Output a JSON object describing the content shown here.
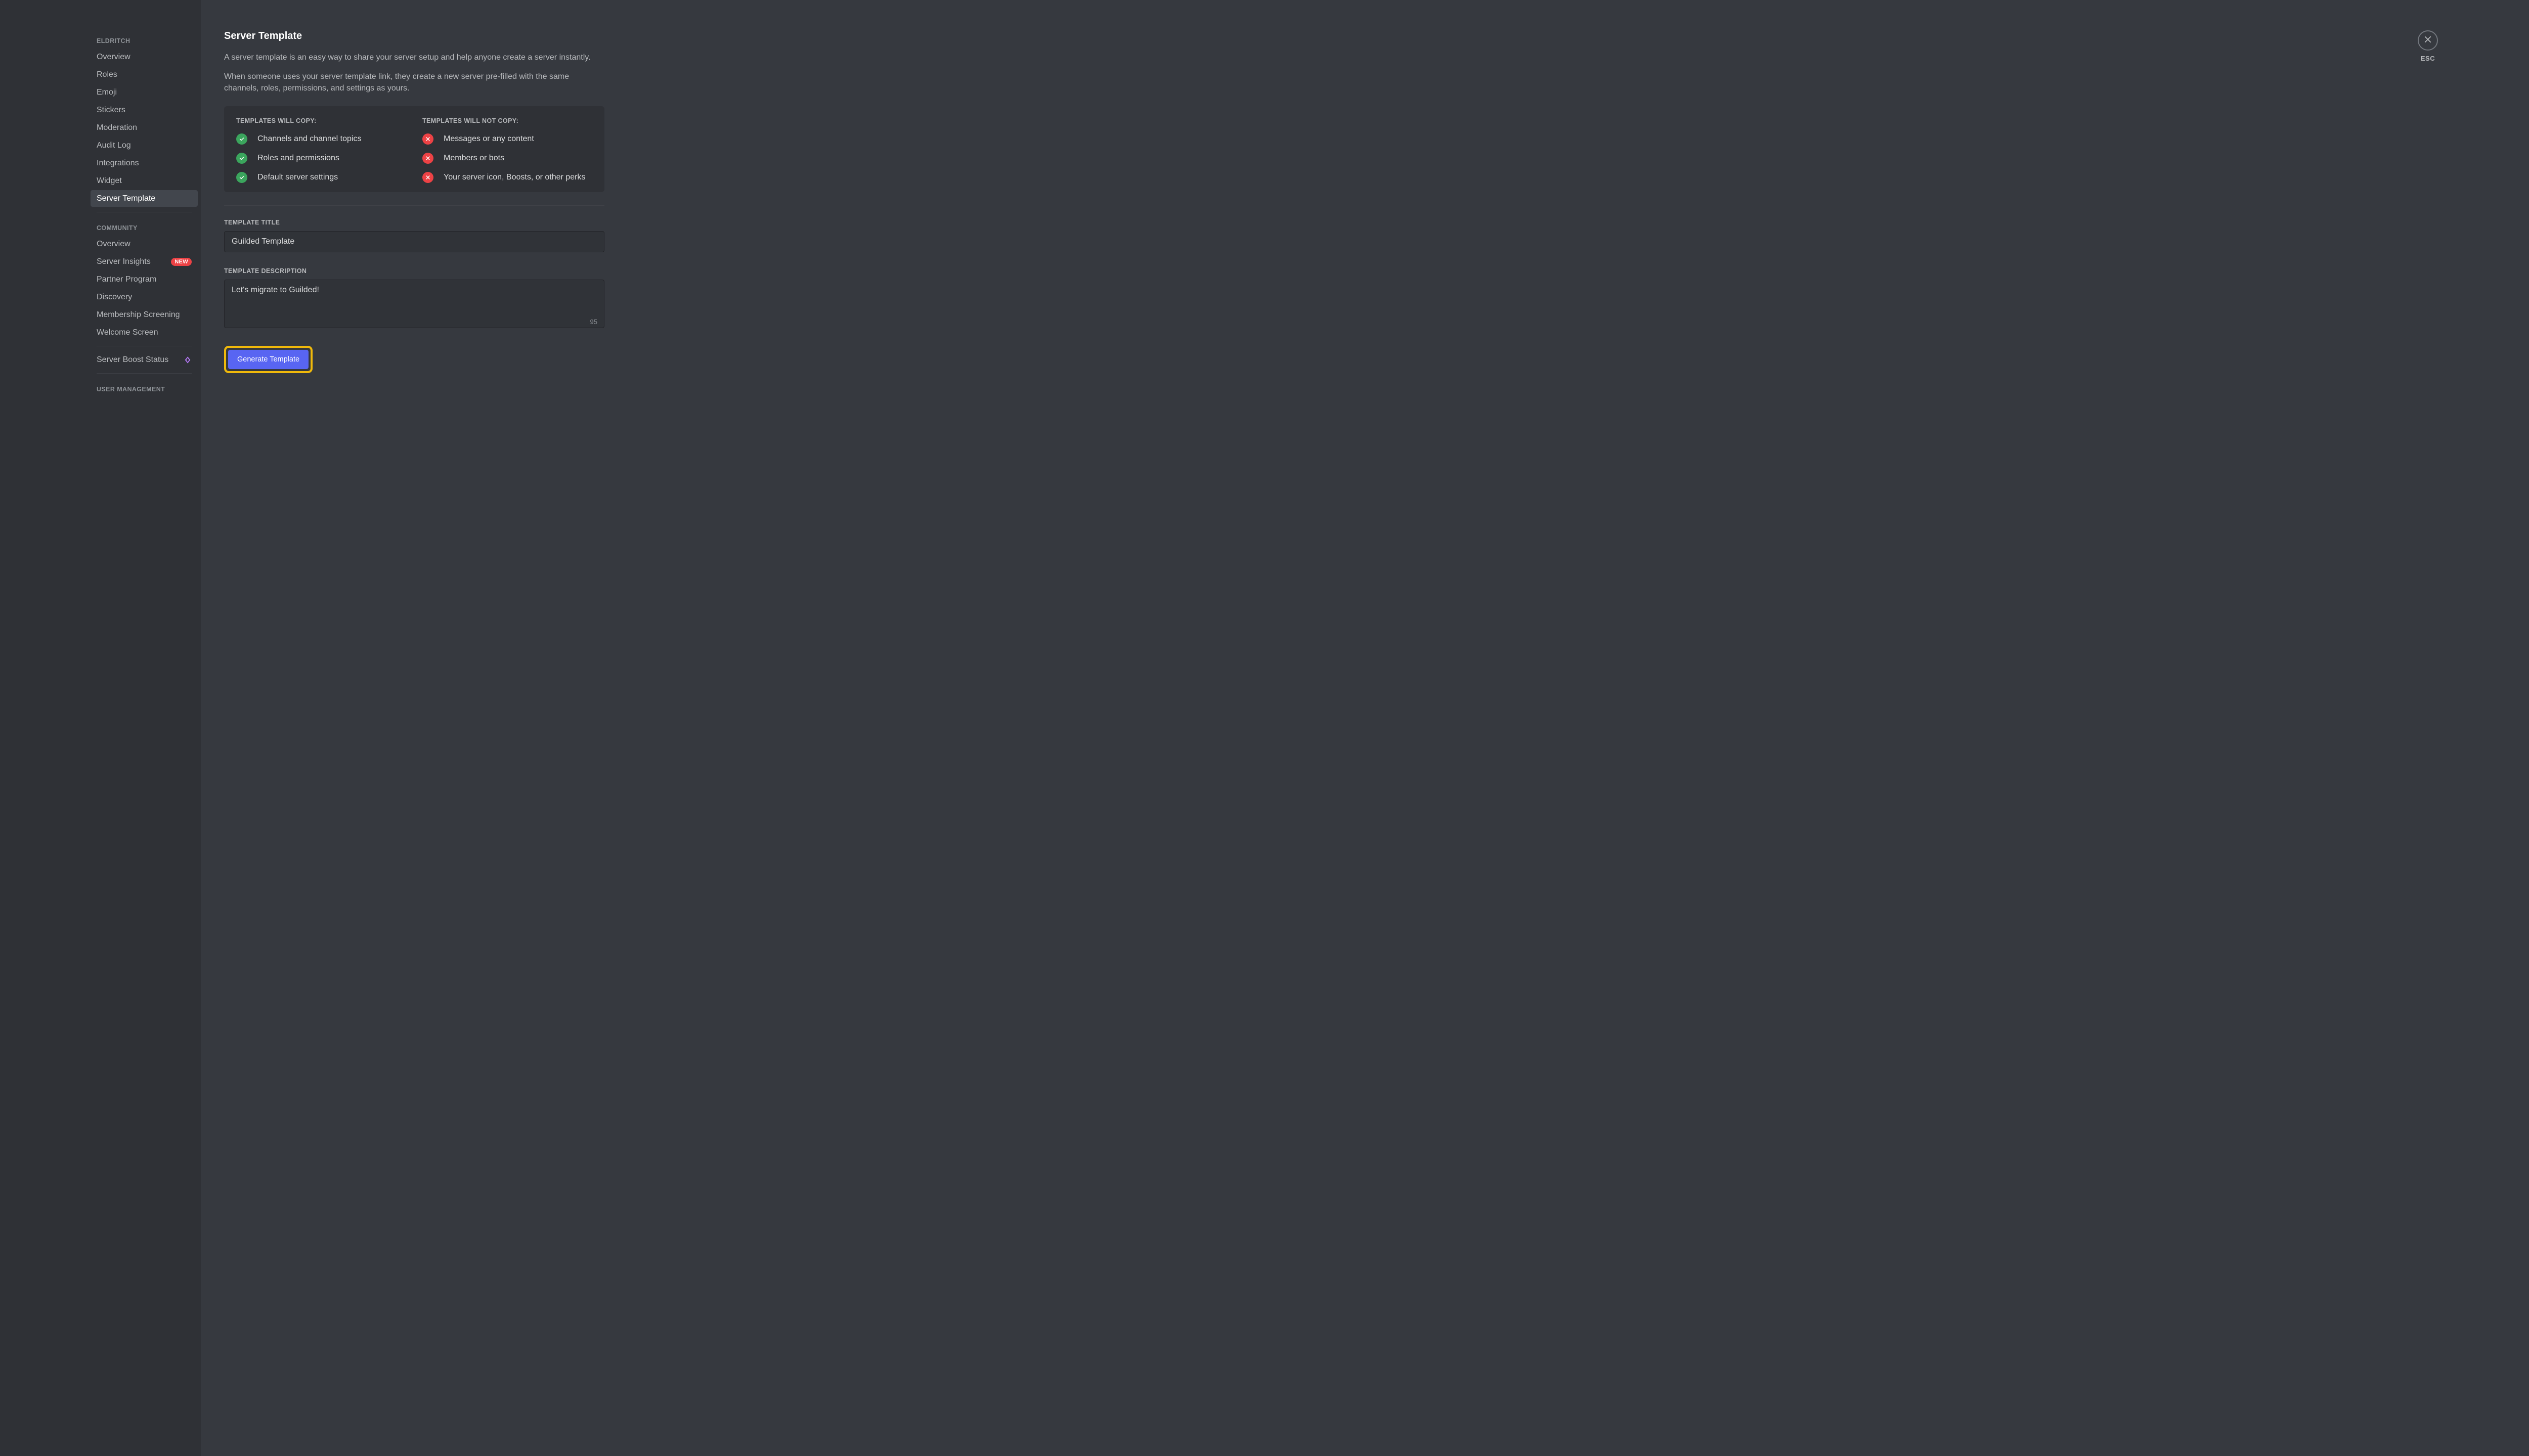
{
  "sidebar": {
    "server_name": "ELDRITCH",
    "section1": [
      {
        "label": "Overview"
      },
      {
        "label": "Roles"
      },
      {
        "label": "Emoji"
      },
      {
        "label": "Stickers"
      },
      {
        "label": "Moderation"
      },
      {
        "label": "Audit Log"
      },
      {
        "label": "Integrations"
      },
      {
        "label": "Widget"
      },
      {
        "label": "Server Template"
      }
    ],
    "community_label": "COMMUNITY",
    "section2": [
      {
        "label": "Overview"
      },
      {
        "label": "Server Insights",
        "badge": "NEW"
      },
      {
        "label": "Partner Program"
      },
      {
        "label": "Discovery"
      },
      {
        "label": "Membership Screening"
      },
      {
        "label": "Welcome Screen"
      }
    ],
    "boost_label": "Server Boost Status",
    "user_mgmt_label": "USER MANAGEMENT"
  },
  "main": {
    "title": "Server Template",
    "desc1": "A server template is an easy way to share your server setup and help anyone create a server instantly.",
    "desc2": "When someone uses your server template link, they create a new server pre-filled with the same channels, roles, permissions, and settings as yours.",
    "will_copy_header": "TEMPLATES WILL COPY:",
    "will_not_copy_header": "TEMPLATES WILL NOT COPY:",
    "will_copy": [
      "Channels and channel topics",
      "Roles and permissions",
      "Default server settings"
    ],
    "will_not_copy": [
      "Messages or any content",
      "Members or bots",
      "Your server icon, Boosts, or other perks"
    ],
    "title_label": "TEMPLATE TITLE",
    "title_value": "Guilded Template",
    "desc_label": "TEMPLATE DESCRIPTION",
    "desc_value": "Let's migrate to Guilded!",
    "desc_count": "95",
    "generate_label": "Generate Template"
  },
  "close": {
    "label": "ESC"
  }
}
